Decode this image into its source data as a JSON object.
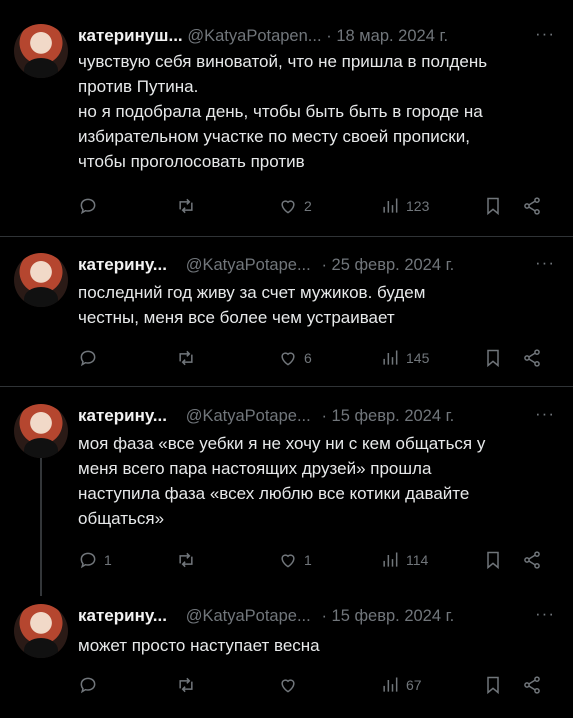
{
  "more_label": "···",
  "tweets": [
    {
      "name": "катеринуш...",
      "handle": "@KatyaPotapen...",
      "date": "· 18 мар. 2024 г.",
      "lines": [
        "чувствую себя виноватой, что не пришла в полдень",
        "против Путина.",
        "но я подобрала день, чтобы быть быть в городе на",
        "избирательном участке по месту своей прописки,",
        "чтобы проголосовать против"
      ],
      "replies": "",
      "retweets": "",
      "likes": "2",
      "views": "123"
    },
    {
      "name": "катерину...",
      "handle": "@KatyaPotape...",
      "date": "· 25 февр. 2024 г.",
      "lines": [
        "последний год живу за счет мужиков. будем",
        "честны, меня все более чем устраивает"
      ],
      "replies": "",
      "retweets": "",
      "likes": "6",
      "views": "145"
    },
    {
      "name": "катерину...",
      "handle": "@KatyaPotape...",
      "date": "· 15 февр. 2024 г.",
      "lines": [
        "моя фаза «все уебки я не хочу ни с кем общаться у",
        "меня всего пара настоящих друзей» прошла",
        "наступила  фаза «всех люблю все котики давайте",
        "общаться»"
      ],
      "replies": "1",
      "retweets": "",
      "likes": "1",
      "views": "114"
    },
    {
      "name": "катерину...",
      "handle": "@KatyaPotape...",
      "date": "· 15 февр. 2024 г.",
      "lines": [
        "может просто наступает весна"
      ],
      "replies": "",
      "retweets": "",
      "likes": "",
      "views": "67"
    }
  ]
}
